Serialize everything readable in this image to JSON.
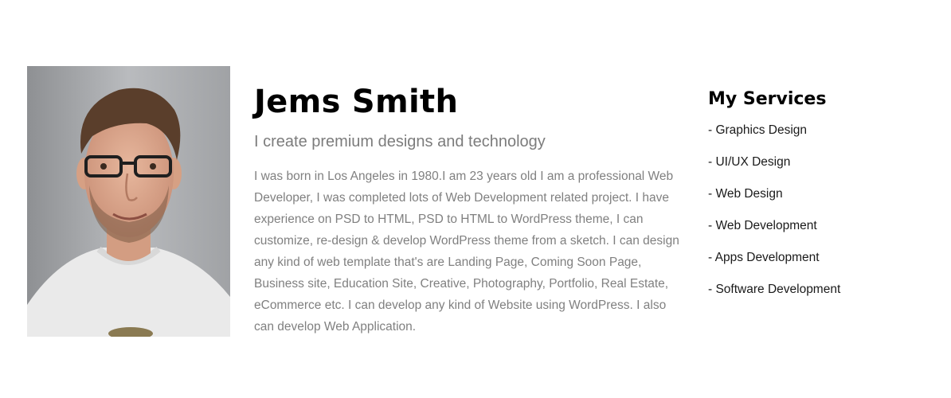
{
  "profile": {
    "name": "Jems Smith",
    "tagline": "I create premium designs and technology",
    "bio": "I was born in Los Angeles in 1980.I am 23 years old I am a professional Web Developer, I was completed lots of Web Development related project. I have experience on PSD to HTML, PSD to HTML to WordPress theme, I can customize, re-design & develop WordPress theme from a sketch. I can design any kind of web template that's are Landing Page, Coming Soon Page, Business site, Education Site, Creative, Photography, Portfolio, Real Estate, eCommerce etc. I can develop any kind of Website using WordPress. I also can develop Web Application."
  },
  "services": {
    "title": "My Services",
    "items": [
      {
        "label": "- Graphics Design"
      },
      {
        "label": "- UI/UX Design"
      },
      {
        "label": "- Web Design"
      },
      {
        "label": "- Web Development"
      },
      {
        "label": "- Apps Development"
      },
      {
        "label": "- Software Development"
      }
    ]
  },
  "colors": {
    "heading": "#000000",
    "muted_text": "#808080",
    "list_text": "#1a1a1a",
    "background": "#ffffff"
  }
}
